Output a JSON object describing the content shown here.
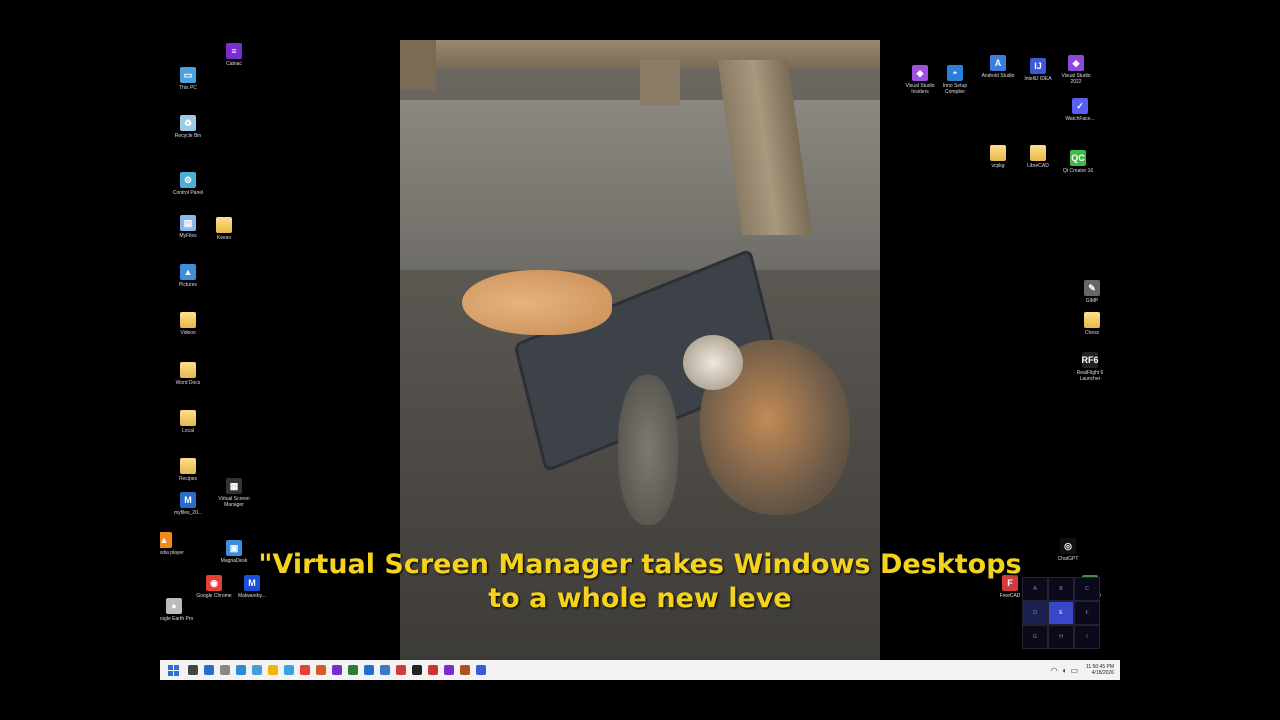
{
  "desktop": {
    "left_icons": [
      {
        "name": "this-pc",
        "label": "This PC",
        "color": "#4da3e0",
        "glyph": "▭"
      },
      {
        "name": "recycle-bin",
        "label": "Recycle Bin",
        "color": "#9cc9e8",
        "glyph": "♻"
      },
      {
        "name": "control-panel",
        "label": "Control Panel",
        "color": "#4ab0d6",
        "glyph": "⚙"
      },
      {
        "name": "myfiles",
        "label": "MyFiles",
        "color": "#8cb8e8",
        "glyph": "▤"
      },
      {
        "name": "pictures",
        "label": "Pictures",
        "color": "#3f8fd8",
        "glyph": "▲"
      },
      {
        "name": "videos",
        "label": "Videos",
        "color": "folder",
        "glyph": ""
      },
      {
        "name": "word-docs",
        "label": "Word Docs",
        "color": "folder",
        "glyph": ""
      },
      {
        "name": "local",
        "label": "Local",
        "color": "folder",
        "glyph": ""
      },
      {
        "name": "recipes",
        "label": "Recipes",
        "color": "folder",
        "glyph": ""
      },
      {
        "name": "myfiles-20",
        "label": "myfiles_20...",
        "color": "#2a6cc7",
        "glyph": "M"
      },
      {
        "name": "vlc-media-player",
        "label": "VLC media player",
        "color": "#f08a18",
        "glyph": "▲"
      },
      {
        "name": "google-earth-pro",
        "label": "Google Earth Pro",
        "color": "#bbbbbb",
        "glyph": "●"
      }
    ],
    "left_col2_icons": [
      {
        "name": "catnac",
        "label": "Catnac",
        "color": "#7b2ccf",
        "glyph": "≡"
      },
      {
        "name": "keeso",
        "label": "Keeso",
        "color": "folder",
        "glyph": ""
      },
      {
        "name": "virtual-screen-manager",
        "label": "Virtual Screen Manager",
        "color": "#333333",
        "glyph": "▦"
      },
      {
        "name": "magnadesk",
        "label": "MagnaDesk",
        "color": "#3c8fd8",
        "glyph": "▣"
      },
      {
        "name": "google-chrome",
        "label": "Google Chrome",
        "color": "#e34133",
        "glyph": "◉"
      },
      {
        "name": "malwarebytes",
        "label": "Malwareby...",
        "color": "#1a4fd8",
        "glyph": "M"
      }
    ],
    "right_icons": [
      {
        "name": "visual-studio-insiders",
        "label": "Visual Studio Insiders",
        "color": "#a050e0",
        "glyph": "◆"
      },
      {
        "name": "inno-setup-compiler",
        "label": "Inno Setup Compiler",
        "color": "#2a80d8",
        "glyph": "◓"
      },
      {
        "name": "android-studio",
        "label": "Android Studio",
        "color": "#3d7de0",
        "glyph": "A"
      },
      {
        "name": "intellij-idea",
        "label": "IntelliJ IDEA",
        "color": "#3a5ad8",
        "glyph": "IJ"
      },
      {
        "name": "visual-studio-2022",
        "label": "Visual Studio 2022",
        "color": "#8e48d8",
        "glyph": "◆"
      },
      {
        "name": "watchface",
        "label": "WatchFace...",
        "color": "#5a5ef0",
        "glyph": "✓"
      },
      {
        "name": "vcpkg",
        "label": "vcpkg",
        "color": "folder",
        "glyph": ""
      },
      {
        "name": "librecad-folder",
        "label": "LibreCAD",
        "color": "folder",
        "glyph": ""
      },
      {
        "name": "qt-creator",
        "label": "Qt Creator 16",
        "color": "#41b94a",
        "glyph": "QC"
      },
      {
        "name": "gimp",
        "label": "GIMP",
        "color": "#666666",
        "glyph": "✎"
      },
      {
        "name": "chess",
        "label": "Chess",
        "color": "folder",
        "glyph": ""
      },
      {
        "name": "realflight",
        "label": "RealFlight 6 Launcher",
        "color": "#222222",
        "glyph": "RF6"
      },
      {
        "name": "chatgpt",
        "label": "ChatGPT",
        "color": "#111111",
        "glyph": "◎"
      },
      {
        "name": "freecad",
        "label": "FreeCAD",
        "color": "#d03c3c",
        "glyph": "F"
      },
      {
        "name": "librecad",
        "label": "LibreCAD",
        "color": "#4a8a4a",
        "glyph": "▤"
      }
    ]
  },
  "subtitle": {
    "line1": "\"Virtual Screen Manager takes Windows Desktops",
    "line2": "to a whole new leve"
  },
  "vsm_grid": [
    "A",
    "B",
    "C",
    "D",
    "E",
    "F",
    "G",
    "H",
    "I"
  ],
  "vsm_active": "E",
  "taskbar": {
    "time": "11:50:45 PM",
    "date": "4/18/2026"
  }
}
